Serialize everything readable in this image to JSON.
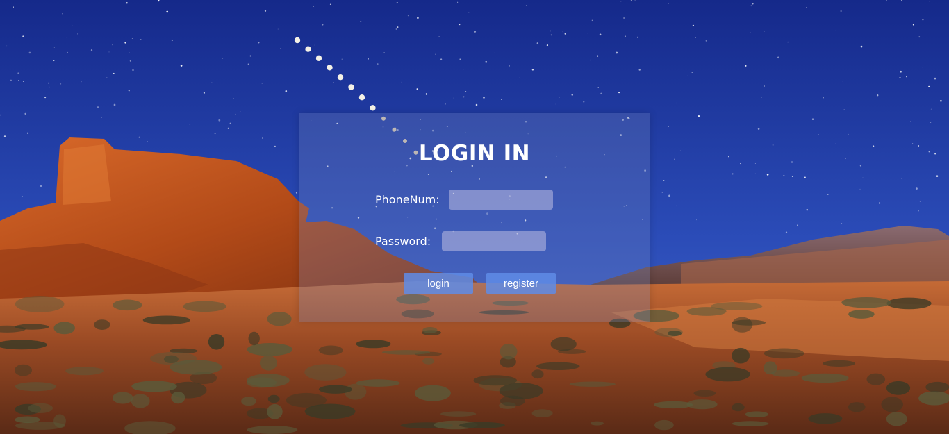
{
  "login": {
    "title": "LOGIN IN",
    "phone_label": "PhoneNum:",
    "phone_value": "",
    "password_label": "Password:",
    "password_value": "",
    "login_button": "login",
    "register_button": "register"
  },
  "colors": {
    "sky_top": "#1a2f8c",
    "sky_bottom": "#3f63c9",
    "rock": "#c3561c",
    "sand": "#a04a1e",
    "panel": "#7887be",
    "button": "#5f8ce6"
  },
  "background": {
    "description_icon": "desert-night-sky-image"
  }
}
